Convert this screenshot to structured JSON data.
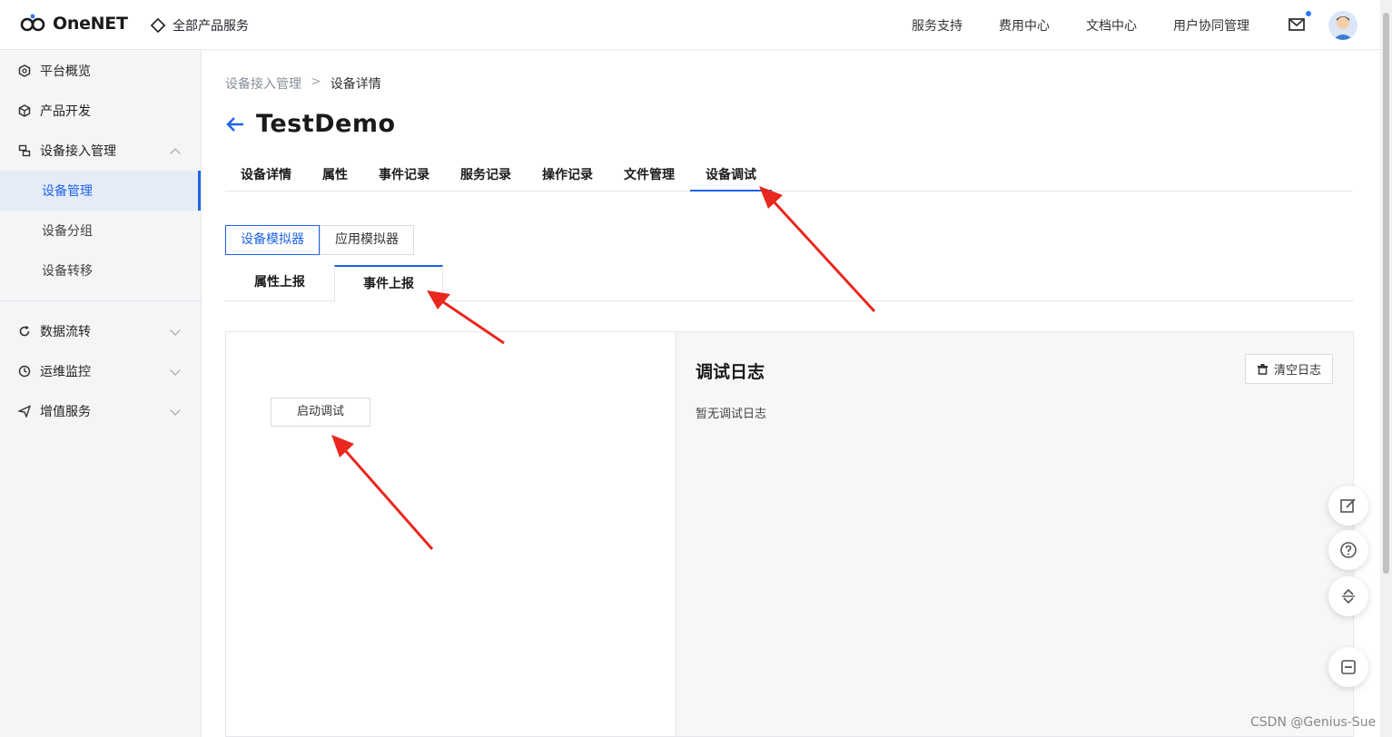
{
  "header": {
    "logo_text": "OneNET",
    "all_products": "全部产品服务",
    "nav": [
      "服务支持",
      "费用中心",
      "文档中心",
      "用户协同管理"
    ]
  },
  "sidebar": {
    "items": [
      {
        "label": "平台概览",
        "icon": "hexagon-icon"
      },
      {
        "label": "产品开发",
        "icon": "cube-icon"
      },
      {
        "label": "设备接入管理",
        "icon": "device-icon"
      }
    ],
    "sub_items": [
      {
        "label": "设备管理",
        "active": true
      },
      {
        "label": "设备分组",
        "active": false
      },
      {
        "label": "设备转移",
        "active": false
      }
    ],
    "items2": [
      {
        "label": "数据流转",
        "icon": "refresh-icon"
      },
      {
        "label": "运维监控",
        "icon": "clock-icon"
      },
      {
        "label": "增值服务",
        "icon": "send-icon"
      }
    ]
  },
  "breadcrumb": {
    "parent": "设备接入管理",
    "separator": ">",
    "current": "设备详情"
  },
  "page_title": "TestDemo",
  "tabs": [
    "设备详情",
    "属性",
    "事件记录",
    "服务记录",
    "操作记录",
    "文件管理",
    "设备调试"
  ],
  "active_tab": "设备调试",
  "simulator": {
    "device": "设备模拟器",
    "app": "应用模拟器"
  },
  "subtabs": [
    "属性上报",
    "事件上报"
  ],
  "debug": {
    "start_button": "启动调试"
  },
  "log": {
    "title": "调试日志",
    "clear_button": "清空日志",
    "empty_text": "暂无调试日志"
  },
  "watermark": "CSDN @Genius-Sue",
  "colors": {
    "accent": "#1f63e8",
    "annotation": "#e8281e"
  }
}
